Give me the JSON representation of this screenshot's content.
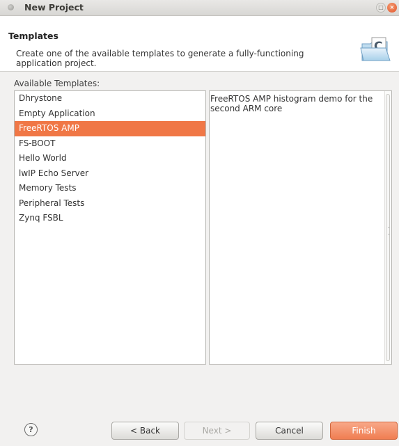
{
  "window": {
    "title": "New Project"
  },
  "header": {
    "title": "Templates",
    "description": "Create one of the available templates to generate a fully-functioning application project.",
    "icon": "new-c-project-wizard-icon"
  },
  "templates": {
    "label": "Available Templates:",
    "items": [
      "Dhrystone",
      "Empty Application",
      "FreeRTOS AMP",
      "FS-BOOT",
      "Hello World",
      "lwIP Echo Server",
      "Memory Tests",
      "Peripheral Tests",
      "Zynq FSBL"
    ],
    "selected": "FreeRTOS AMP",
    "selected_color": "#f07746"
  },
  "description": {
    "text": "FreeRTOS AMP histogram demo for the second ARM core"
  },
  "buttons": {
    "help": "?",
    "back": "< Back",
    "next": "Next >",
    "cancel": "Cancel",
    "finish": "Finish"
  }
}
